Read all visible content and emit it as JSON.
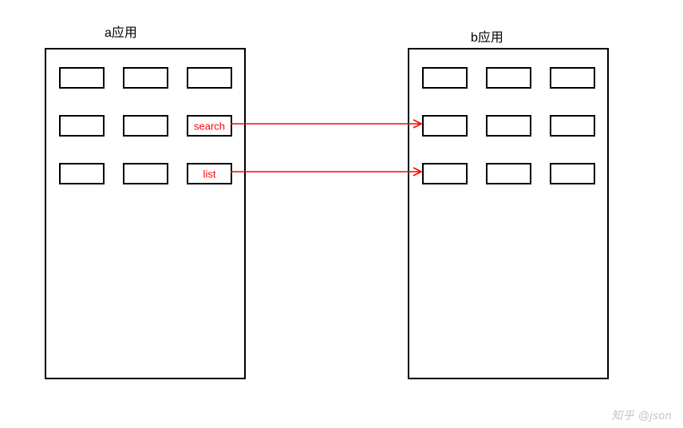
{
  "diagram": {
    "left_title": "a应用",
    "right_title": "b应用",
    "labels": {
      "search": "search",
      "list": "list"
    },
    "arrows": [
      {
        "name": "search",
        "from_cell": [
          1,
          2
        ],
        "to_cell": [
          1,
          0
        ]
      },
      {
        "name": "list",
        "from_cell": [
          2,
          2
        ],
        "to_cell": [
          2,
          0
        ]
      }
    ],
    "colors": {
      "arrow": "#ff0000",
      "label": "#ff0000",
      "border": "#000000"
    }
  },
  "watermark": "知乎 @json"
}
